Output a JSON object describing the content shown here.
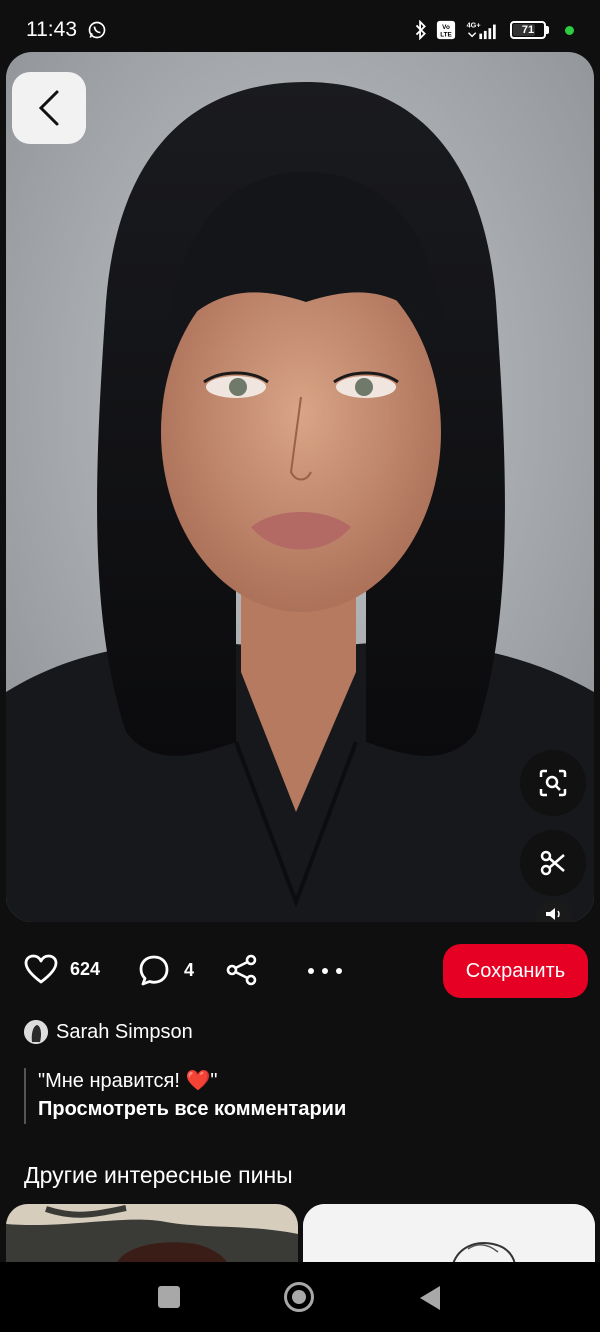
{
  "status_bar": {
    "time": "11:43",
    "battery_level": "71",
    "network": "4G+",
    "volte": "Vo LTE",
    "icons": [
      "whatsapp-icon",
      "bluetooth-icon",
      "volte-icon",
      "signal-icon",
      "battery-icon",
      "green-dot"
    ]
  },
  "pin": {
    "actions": {
      "likes_count": "624",
      "comments_count": "4",
      "save_label": "Сохранить"
    },
    "author": "Sarah Simpson",
    "comments": {
      "latest": "\"Мне нравится! ❤️\"",
      "view_all": "Просмотреть все комментарии"
    }
  },
  "more_pins": {
    "title": "Другие интересные пины"
  },
  "colors": {
    "background": "#0f0f0f",
    "save_button": "#e60023",
    "image_background": "#9a9ea2"
  }
}
